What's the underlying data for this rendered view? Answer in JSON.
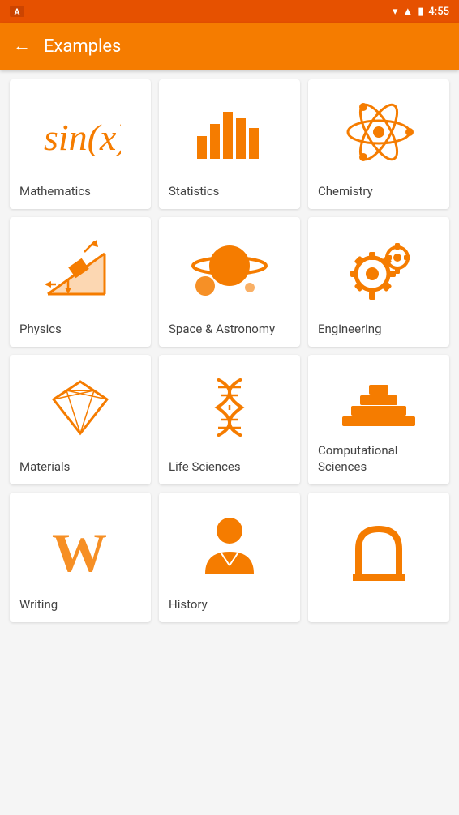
{
  "statusBar": {
    "time": "4:55",
    "icons": [
      "signal",
      "wifi",
      "battery"
    ]
  },
  "appBar": {
    "title": "Examples",
    "backLabel": "←"
  },
  "categories": [
    {
      "id": "mathematics",
      "label": "Mathematics",
      "icon": "math"
    },
    {
      "id": "statistics",
      "label": "Statistics",
      "icon": "stats"
    },
    {
      "id": "chemistry",
      "label": "Chemistry",
      "icon": "atom"
    },
    {
      "id": "physics",
      "label": "Physics",
      "icon": "physics"
    },
    {
      "id": "space-astronomy",
      "label": "Space & Astronomy",
      "icon": "space"
    },
    {
      "id": "engineering",
      "label": "Engineering",
      "icon": "gears"
    },
    {
      "id": "materials",
      "label": "Materials",
      "icon": "diamond"
    },
    {
      "id": "life-sciences",
      "label": "Life Sciences",
      "icon": "dna"
    },
    {
      "id": "computational-sciences",
      "label": "Computational Sciences",
      "icon": "pyramid"
    },
    {
      "id": "writing",
      "label": "Writing",
      "icon": "w-letter"
    },
    {
      "id": "history",
      "label": "History",
      "icon": "person"
    },
    {
      "id": "unknown",
      "label": "",
      "icon": "arch"
    }
  ]
}
